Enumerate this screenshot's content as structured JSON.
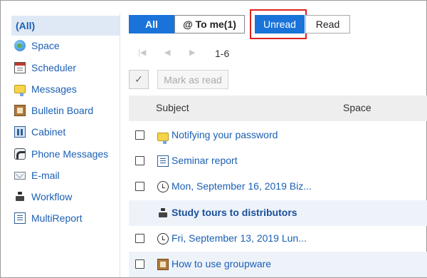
{
  "sidebar": {
    "items": [
      {
        "label": "(All)",
        "icon": "none"
      },
      {
        "label": "Space",
        "icon": "globe-icon"
      },
      {
        "label": "Scheduler",
        "icon": "calendar-icon"
      },
      {
        "label": "Messages",
        "icon": "message-icon"
      },
      {
        "label": "Bulletin Board",
        "icon": "bulletin-board-icon"
      },
      {
        "label": "Cabinet",
        "icon": "cabinet-icon"
      },
      {
        "label": "Phone Messages",
        "icon": "phone-icon"
      },
      {
        "label": "E-mail",
        "icon": "mail-icon"
      },
      {
        "label": "Workflow",
        "icon": "workflow-icon"
      },
      {
        "label": "MultiReport",
        "icon": "report-icon"
      }
    ]
  },
  "filters": {
    "all_label": "All",
    "to_me_label": "@ To me(1)",
    "unread_label": "Unread",
    "read_label": "Read"
  },
  "pager": {
    "range": "1-6"
  },
  "actions": {
    "check_symbol": "✓",
    "mark_as_read": "Mark as read"
  },
  "table": {
    "columns": {
      "subject": "Subject",
      "space": "Space"
    },
    "rows": [
      {
        "subject": "Notifying your password",
        "icon": "message-icon",
        "unread": false
      },
      {
        "subject": "Seminar report",
        "icon": "report-icon",
        "unread": false
      },
      {
        "subject": "Mon, September 16, 2019 Biz...",
        "icon": "clock-icon",
        "unread": false
      },
      {
        "subject": "Study tours to distributors",
        "icon": "workflow-icon",
        "unread": true
      },
      {
        "subject": "Fri, September 13, 2019 Lun...",
        "icon": "clock-icon",
        "unread": false
      },
      {
        "subject": "How to use groupware",
        "icon": "bulletin-board-icon",
        "unread": false
      }
    ]
  },
  "colors": {
    "accent": "#1a73d9",
    "link": "#1a5fb4",
    "highlight": "#e02020"
  }
}
